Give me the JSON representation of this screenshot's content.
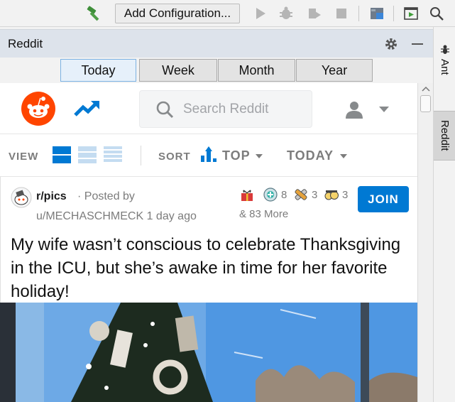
{
  "ide": {
    "add_configuration_label": "Add Configuration...",
    "toolbar_icons": [
      "build-hammer-icon",
      "run-icon",
      "debug-icon",
      "coverage-icon",
      "stop-icon",
      "project-structure-icon",
      "run-window-icon",
      "search-icon"
    ]
  },
  "tool_window": {
    "title": "Reddit",
    "tabs": [
      {
        "label": "Today",
        "active": true
      },
      {
        "label": "Week",
        "active": false
      },
      {
        "label": "Month",
        "active": false
      },
      {
        "label": "Year",
        "active": false
      }
    ],
    "side_tabs": [
      "Ant",
      "Reddit"
    ]
  },
  "reddit": {
    "search_placeholder": "Search Reddit",
    "view_label": "VIEW",
    "sort_label": "SORT",
    "sort_value": "TOP",
    "time_value": "TODAY",
    "accent_color": "#0079d3",
    "brand_color": "#ff4500",
    "post": {
      "subreddit": "r/pics",
      "posted_by_prefix": "· Posted by",
      "author_line": "u/MECHASCHMECK 1 day ago",
      "awards": [
        {
          "icon": "award-gift-icon",
          "count": ""
        },
        {
          "icon": "award-helpful-icon",
          "count": "8"
        },
        {
          "icon": "award-silver-icon",
          "count": "3"
        },
        {
          "icon": "award-wholesome-icon",
          "count": "3"
        }
      ],
      "awards_more": "& 83 More",
      "join_label": "JOIN",
      "title": "My wife wasn’t conscious to celebrate Thanksgiving in the ICU, but she’s awake in time for her favorite holiday!"
    }
  }
}
